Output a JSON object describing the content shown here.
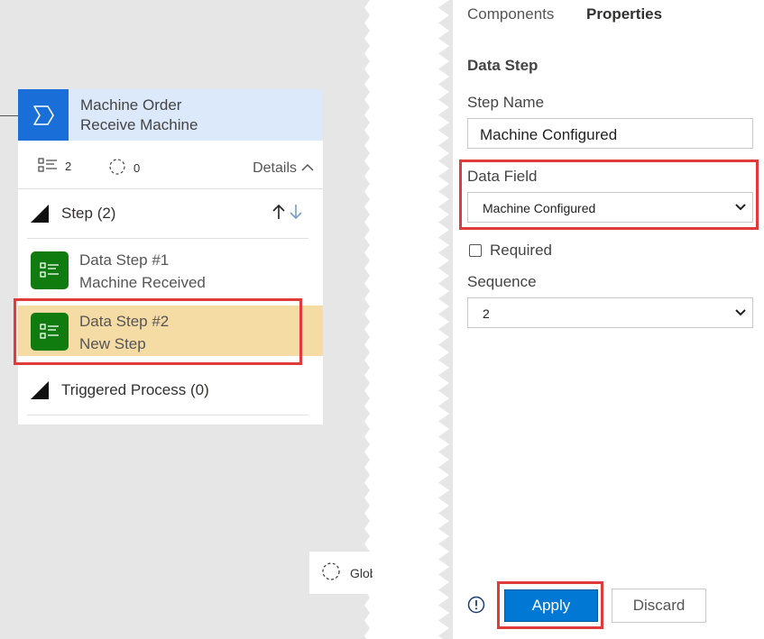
{
  "canvas": {
    "stage": {
      "title": "Machine Order",
      "subtitle": "Receive Machine",
      "steps_count": "2",
      "processes_count": "0",
      "details_label": "Details"
    },
    "sections": {
      "steps_label": "Step (2)",
      "triggered_label": "Triggered Process (0)"
    },
    "steps": [
      {
        "title": "Data Step #1",
        "subtitle": "Machine Received",
        "selected": false
      },
      {
        "title": "Data Step #2",
        "subtitle": "New Step",
        "selected": true
      }
    ],
    "global_tab_label": "Glob"
  },
  "panel": {
    "tabs": {
      "components": "Components",
      "properties": "Properties"
    },
    "title": "Data Step",
    "step_name_label": "Step Name",
    "step_name_value": "Machine Configured",
    "data_field_label": "Data Field",
    "data_field_value": "Machine Configured",
    "required_label": "Required",
    "sequence_label": "Sequence",
    "sequence_value": "2",
    "apply_label": "Apply",
    "discard_label": "Discard"
  },
  "colors": {
    "accent": "#0078d4",
    "stage_icon": "#1a6ed8",
    "stage_header": "#dce9fb",
    "step_icon": "#107c10",
    "selected_step": "#f5dba4",
    "highlight": "#e03a3a",
    "canvas": "#e6e6e6"
  }
}
